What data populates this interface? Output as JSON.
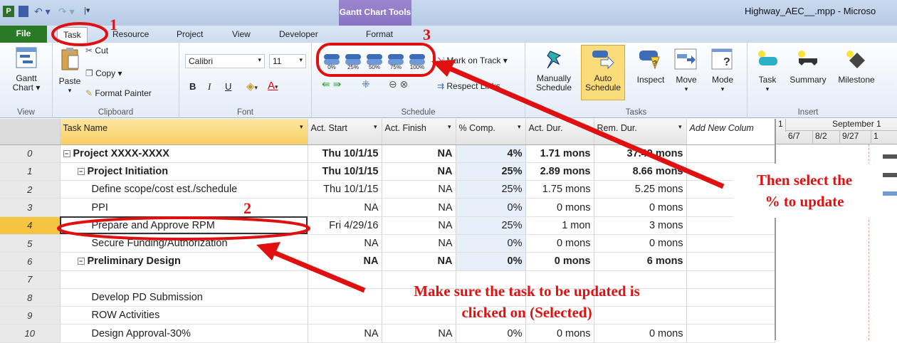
{
  "titlebar": {
    "contextual_tab": "Gantt Chart Tools",
    "window_title": "Highway_AEC__.mpp - Microso"
  },
  "tabs": [
    "Task",
    "Resource",
    "Project",
    "View",
    "Developer"
  ],
  "file_tab": "File",
  "format_tab": "Format",
  "ribbon": {
    "view_group": {
      "gantt_label": "Gantt\nChart ▾",
      "label": "View"
    },
    "clipboard": {
      "paste": "Paste",
      "cut": "Cut",
      "copy": "Copy ▾",
      "format_painter": "Format Painter",
      "label": "Clipboard"
    },
    "font": {
      "family": "Calibri",
      "size": "11",
      "bold": "B",
      "italic": "I",
      "underline": "U",
      "label": "Font"
    },
    "schedule": {
      "pct_buttons": [
        "0%",
        "25%",
        "50%",
        "75%",
        "100%"
      ],
      "mark_on_track": "Mark on Track ▾",
      "respect_links": "Respect Links",
      "label": "Schedule"
    },
    "tasks": {
      "manually": "Manually\nSchedule",
      "auto": "Auto\nSchedule",
      "inspect": "Inspect",
      "move": "Move",
      "mode": "Mode",
      "label": "Tasks"
    },
    "insert": {
      "task": "Task",
      "summary": "Summary",
      "milestone": "Milestone",
      "label": "Insert"
    }
  },
  "table": {
    "columns": [
      "Task Name",
      "Act. Start",
      "Act. Finish",
      "% Comp.",
      "Act. Dur.",
      "Rem. Dur.",
      "Add New Colum"
    ],
    "rows": [
      {
        "id": "0",
        "name": "Project XXXX-XXXX",
        "start": "Thu 10/1/15",
        "finish": "NA",
        "pct": "4%",
        "act": "1.71 mons",
        "rem": "37.49 mons"
      },
      {
        "id": "1",
        "name": "Project Initiation",
        "start": "Thu 10/1/15",
        "finish": "NA",
        "pct": "25%",
        "act": "2.89 mons",
        "rem": "8.66 mons"
      },
      {
        "id": "2",
        "name": "Define scope/cost est./schedule",
        "start": "Thu 10/1/15",
        "finish": "NA",
        "pct": "25%",
        "act": "1.75 mons",
        "rem": "5.25 mons"
      },
      {
        "id": "3",
        "name": "PPI",
        "start": "NA",
        "finish": "NA",
        "pct": "0%",
        "act": "0 mons",
        "rem": "0 mons"
      },
      {
        "id": "4",
        "name": "Prepare and Approve RPM",
        "start": "Fri 4/29/16",
        "finish": "NA",
        "pct": "25%",
        "act": "1 mon",
        "rem": "3 mons"
      },
      {
        "id": "5",
        "name": "Secure Funding/Authorization",
        "start": "NA",
        "finish": "NA",
        "pct": "0%",
        "act": "0 mons",
        "rem": "0 mons"
      },
      {
        "id": "6",
        "name": "Preliminary Design",
        "start": "NA",
        "finish": "NA",
        "pct": "0%",
        "act": "0 mons",
        "rem": "6 mons"
      },
      {
        "id": "7",
        "name": "",
        "start": "",
        "finish": "",
        "pct": "",
        "act": "",
        "rem": ""
      },
      {
        "id": "8",
        "name": "Develop PD Submission",
        "start": "",
        "finish": "",
        "pct": "",
        "act": "",
        "rem": ""
      },
      {
        "id": "9",
        "name": "ROW Activities",
        "start": "",
        "finish": "",
        "pct": "",
        "act": "",
        "rem": ""
      },
      {
        "id": "10",
        "name": "Design Approval-30%",
        "start": "NA",
        "finish": "NA",
        "pct": "0%",
        "act": "0 mons",
        "rem": "0 mons"
      }
    ]
  },
  "timescale": {
    "top": "September 1",
    "top_left": "1",
    "dates": [
      "6/7",
      "8/2",
      "9/27",
      "1"
    ]
  },
  "annotations": {
    "n1": "1",
    "n2": "2",
    "n3": "3",
    "select_pct": "Then select the\n% to update",
    "make_sure": "Make sure the task to be updated is\nclicked on (Selected)"
  },
  "colors": {
    "annotation": "#e01010",
    "selected_row": "#f5c542",
    "file_tab": "#2a7a25",
    "contextual": "#7c67bb"
  }
}
